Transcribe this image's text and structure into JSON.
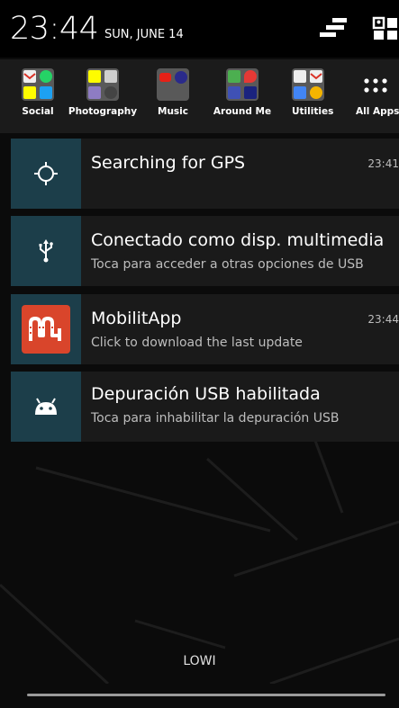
{
  "status_bar": {
    "time": "23:44",
    "date": "SUN, JUNE 14"
  },
  "shortcuts": [
    {
      "label": "Social",
      "icon": "social-folder-icon"
    },
    {
      "label": "Photography",
      "icon": "photography-folder-icon"
    },
    {
      "label": "Music",
      "icon": "music-folder-icon"
    },
    {
      "label": "Around Me",
      "icon": "around-me-folder-icon"
    },
    {
      "label": "Utilities",
      "icon": "utilities-folder-icon"
    },
    {
      "label": "All Apps",
      "icon": "all-apps-icon"
    }
  ],
  "notifications": [
    {
      "title": "Searching for GPS",
      "subtitle": "",
      "time": "23:41",
      "icon": "gps-crosshair-icon"
    },
    {
      "title": "Conectado como disp. multimedia",
      "subtitle": "Toca para acceder a otras opciones de USB",
      "time": "",
      "icon": "usb-icon"
    },
    {
      "title": "MobilitApp",
      "subtitle": "Click to download the last update",
      "time": "23:44",
      "icon": "mobilitapp-icon"
    },
    {
      "title": "Depuración USB habilitada",
      "subtitle": "Toca para inhabilitar la depuración USB",
      "time": "",
      "icon": "android-debug-icon"
    }
  ],
  "carrier": "LOWI",
  "colors": {
    "icon_panel": "#1c3e4a",
    "mobilitapp_brand": "#d9452b"
  }
}
